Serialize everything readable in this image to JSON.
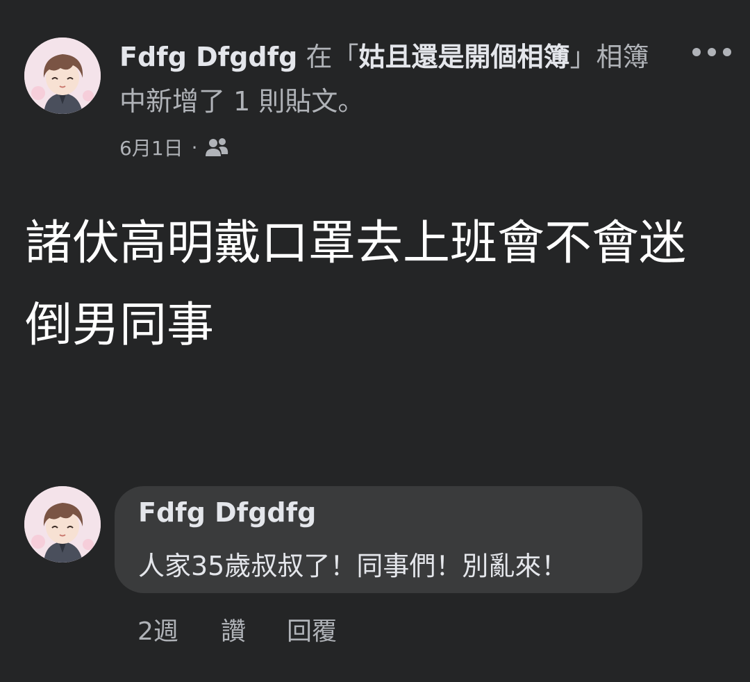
{
  "post": {
    "author": "Fdfg Dfgdfg",
    "action_prefix": "在",
    "album_open": "「",
    "album_name": "姑且還是開個相簿",
    "album_close": "」",
    "action_suffix": "相簿中新增了 1 則貼文。",
    "date": "6月1日",
    "separator": "·",
    "audience_icon": "friends-icon",
    "more_icon": "more-dots-icon",
    "body": "諸伏高明戴口罩去上班會不會迷倒男同事"
  },
  "comment": {
    "author": "Fdfg Dfgdfg",
    "text": "人家35歲叔叔了！同事們！別亂來！",
    "time": "2週",
    "like_label": "讚",
    "reply_label": "回覆"
  },
  "colors": {
    "background": "#242526",
    "bubble": "#3a3b3c",
    "primary_text": "#e4e6eb",
    "secondary_text": "#b0b3b8"
  }
}
